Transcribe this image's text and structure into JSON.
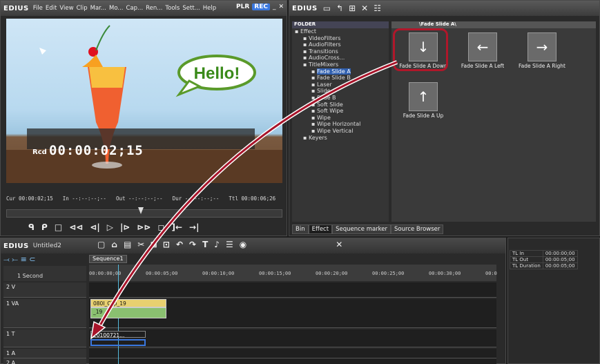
{
  "player": {
    "app_name": "EDIUS",
    "menu": [
      "File",
      "Edit",
      "View",
      "Clip",
      "Mar...",
      "Mo...",
      "Cap...",
      "Ren...",
      "Tools",
      "Sett...",
      "Help"
    ],
    "mode": "PLR",
    "rec_label": "REC",
    "bubble_text": "Hello!",
    "rcd_label": "Rcd",
    "timecode": "00:00:02;15",
    "cur_label": "Cur 00:00:02;15",
    "in_label": "In --:--:--;--",
    "out_label": "Out --:--:--;--",
    "dur_label": "Dur --:--:--;--",
    "ttl_label": "Ttl 00:00:06;26"
  },
  "effect_panel": {
    "app_name": "EDIUS",
    "folder_header": "FOLDER",
    "grid_header": "\\Fade Slide A\\",
    "tree": [
      {
        "label": "Effect",
        "indent": 0,
        "selected": false
      },
      {
        "label": "VideoFilters",
        "indent": 1,
        "selected": false
      },
      {
        "label": "AudioFilters",
        "indent": 1,
        "selected": false
      },
      {
        "label": "Transitions",
        "indent": 1,
        "selected": false
      },
      {
        "label": "AudioCross...",
        "indent": 1,
        "selected": false
      },
      {
        "label": "TitleMixers",
        "indent": 1,
        "selected": false
      },
      {
        "label": "Fade Slide A",
        "indent": 2,
        "selected": true
      },
      {
        "label": "Fade Slide B",
        "indent": 2,
        "selected": false
      },
      {
        "label": "Laser",
        "indent": 2,
        "selected": false
      },
      {
        "label": "Slide A",
        "indent": 2,
        "selected": false
      },
      {
        "label": "Slide B",
        "indent": 2,
        "selected": false
      },
      {
        "label": "Soft Slide",
        "indent": 2,
        "selected": false
      },
      {
        "label": "Soft Wipe",
        "indent": 2,
        "selected": false
      },
      {
        "label": "Wipe",
        "indent": 2,
        "selected": false
      },
      {
        "label": "Wipe Horizontal",
        "indent": 2,
        "selected": false
      },
      {
        "label": "Wipe Vertical",
        "indent": 2,
        "selected": false
      },
      {
        "label": "Keyers",
        "indent": 1,
        "selected": false
      }
    ],
    "effects": [
      {
        "label": "Fade Slide A Down",
        "arrow": "↓"
      },
      {
        "label": "Fade Slide A Left",
        "arrow": "←"
      },
      {
        "label": "Fade Slide A Right",
        "arrow": "→"
      },
      {
        "label": "Fade Slide A Up",
        "arrow": "↑"
      }
    ],
    "tabs": [
      "Bin",
      "Effect",
      "Sequence marker",
      "Source Browser"
    ],
    "active_tab": "Effect"
  },
  "timeline": {
    "app_name": "EDIUS",
    "project": "Untitled2",
    "sequence_tab": "Sequence1",
    "scale": "1 Second",
    "ruler": [
      "00:00:00;00",
      "00:00:05;00",
      "00:00:10;00",
      "00:00:15;00",
      "00:00:20;00",
      "00:00:25;00",
      "00:00:30;00",
      "00:0"
    ],
    "tracks": [
      "2 V",
      "1 VA",
      "1 T",
      "1 A",
      "2 A"
    ],
    "clips": {
      "va_video": "080I_Clip_19",
      "va_audio": "_19",
      "title": "20100721..."
    }
  },
  "side_panel": {
    "rows": [
      {
        "label": "TL In",
        "value": "00:00:00;00"
      },
      {
        "label": "TL Out",
        "value": "00:00:05;00"
      },
      {
        "label": "TL Duration",
        "value": "00:00:05;00"
      }
    ]
  },
  "colors": {
    "accent": "#3a78e0",
    "highlight": "#b0172a",
    "drag_arrow": "#a8142a"
  }
}
